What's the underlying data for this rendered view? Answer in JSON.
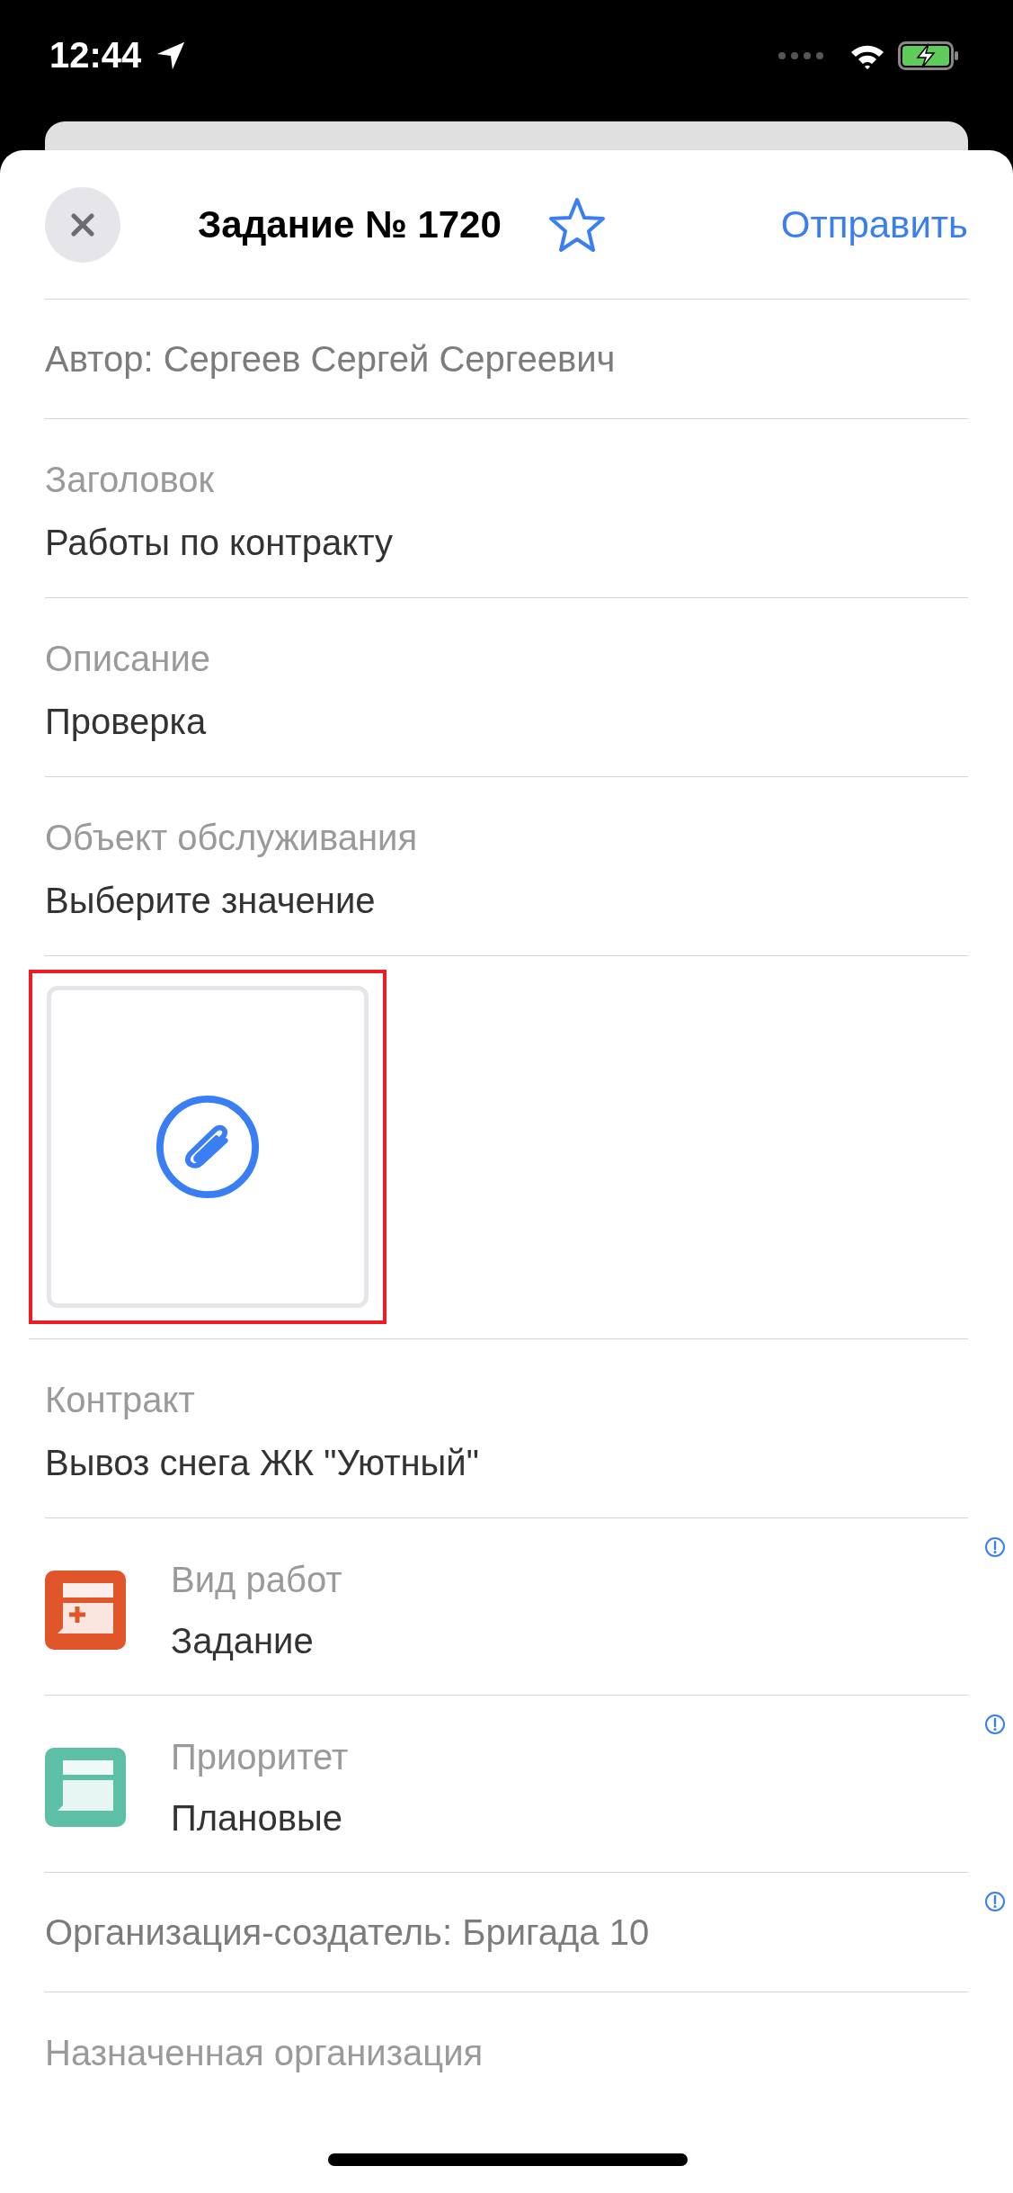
{
  "status_bar": {
    "time": "12:44"
  },
  "header": {
    "title": "Задание № 1720",
    "send_label": "Отправить",
    "favorite": false
  },
  "fields": [
    {
      "kind": "line",
      "text": "Автор: Сергеев Сергей Сергеевич",
      "info": false
    },
    {
      "kind": "field",
      "label": "Заголовок",
      "value": "Работы по контракту",
      "info": false
    },
    {
      "kind": "field",
      "label": "Описание",
      "value": "Проверка",
      "info": false
    },
    {
      "kind": "field",
      "label": "Объект обслуживания",
      "value": "Выберите значение",
      "info": false
    },
    {
      "kind": "attachment",
      "highlighted": true
    },
    {
      "kind": "field",
      "label": "Контракт",
      "value": "Вывоз снега ЖК \"Уютный\"",
      "info": false
    },
    {
      "kind": "icon_field",
      "label": "Вид работ",
      "value": "Задание",
      "info": true,
      "icon": {
        "kind": "plus",
        "color": "#e0562a"
      }
    },
    {
      "kind": "icon_field",
      "label": "Приоритет",
      "value": "Плановые",
      "info": true,
      "icon": {
        "kind": "plain",
        "color": "#5dbfa5"
      }
    },
    {
      "kind": "line",
      "text": "Организация-создатель: Бригада 10",
      "info": true
    },
    {
      "kind": "field",
      "label": "Назначенная организация",
      "info": false
    }
  ]
}
